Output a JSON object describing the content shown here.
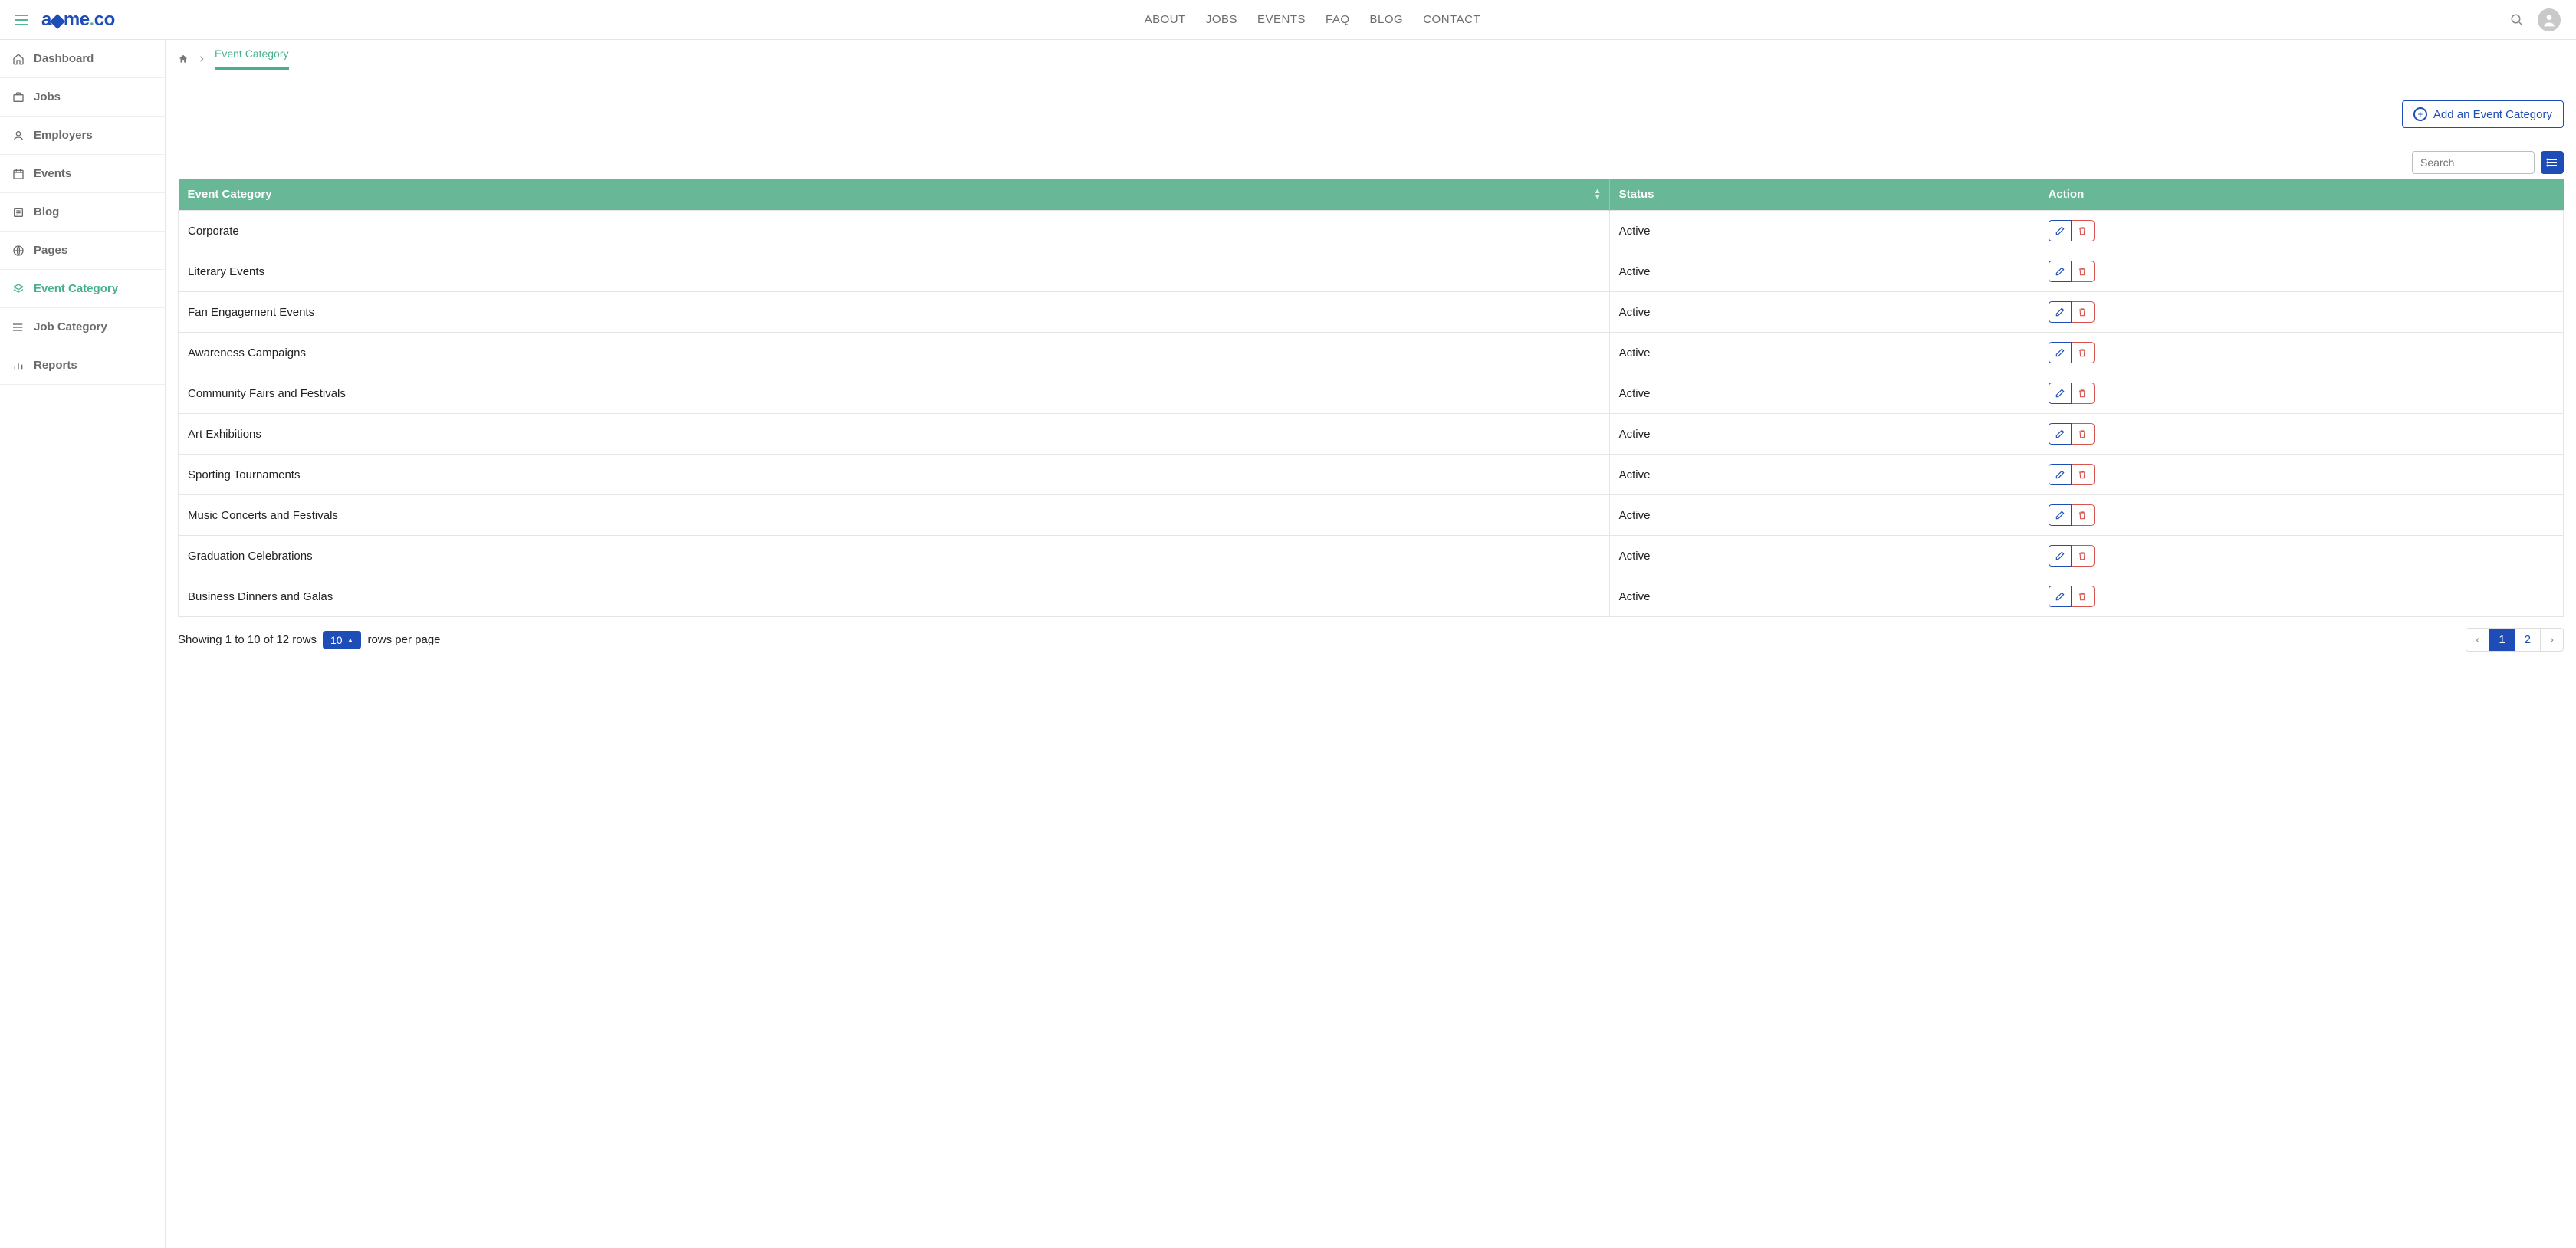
{
  "topnav": [
    "ABOUT",
    "JOBS",
    "EVENTS",
    "FAQ",
    "BLOG",
    "CONTACT"
  ],
  "sidebar": {
    "items": [
      {
        "label": "Dashboard"
      },
      {
        "label": "Jobs"
      },
      {
        "label": "Employers"
      },
      {
        "label": "Events"
      },
      {
        "label": "Blog"
      },
      {
        "label": "Pages"
      },
      {
        "label": "Event Category",
        "active": true
      },
      {
        "label": "Job Category"
      },
      {
        "label": "Reports"
      }
    ]
  },
  "breadcrumb": {
    "current": "Event Category"
  },
  "toolbar": {
    "add_label": "Add an Event Category"
  },
  "search": {
    "placeholder": "Search"
  },
  "table": {
    "columns": [
      "Event Category",
      "Status",
      "Action"
    ],
    "rows": [
      {
        "name": "Corporate",
        "status": "Active"
      },
      {
        "name": "Literary Events",
        "status": "Active"
      },
      {
        "name": "Fan Engagement Events",
        "status": "Active"
      },
      {
        "name": "Awareness Campaigns",
        "status": "Active"
      },
      {
        "name": "Community Fairs and Festivals",
        "status": "Active"
      },
      {
        "name": "Art Exhibitions",
        "status": "Active"
      },
      {
        "name": "Sporting Tournaments",
        "status": "Active"
      },
      {
        "name": "Music Concerts and Festivals",
        "status": "Active"
      },
      {
        "name": "Graduation Celebrations",
        "status": "Active"
      },
      {
        "name": "Business Dinners and Galas",
        "status": "Active"
      }
    ]
  },
  "footer": {
    "info_prefix": "Showing 1 to 10 of 12 rows",
    "page_size": "10",
    "info_suffix": "rows per page"
  },
  "pagination": {
    "prev": "‹",
    "pages": [
      "1",
      "2"
    ],
    "active": "1",
    "next": "›"
  }
}
